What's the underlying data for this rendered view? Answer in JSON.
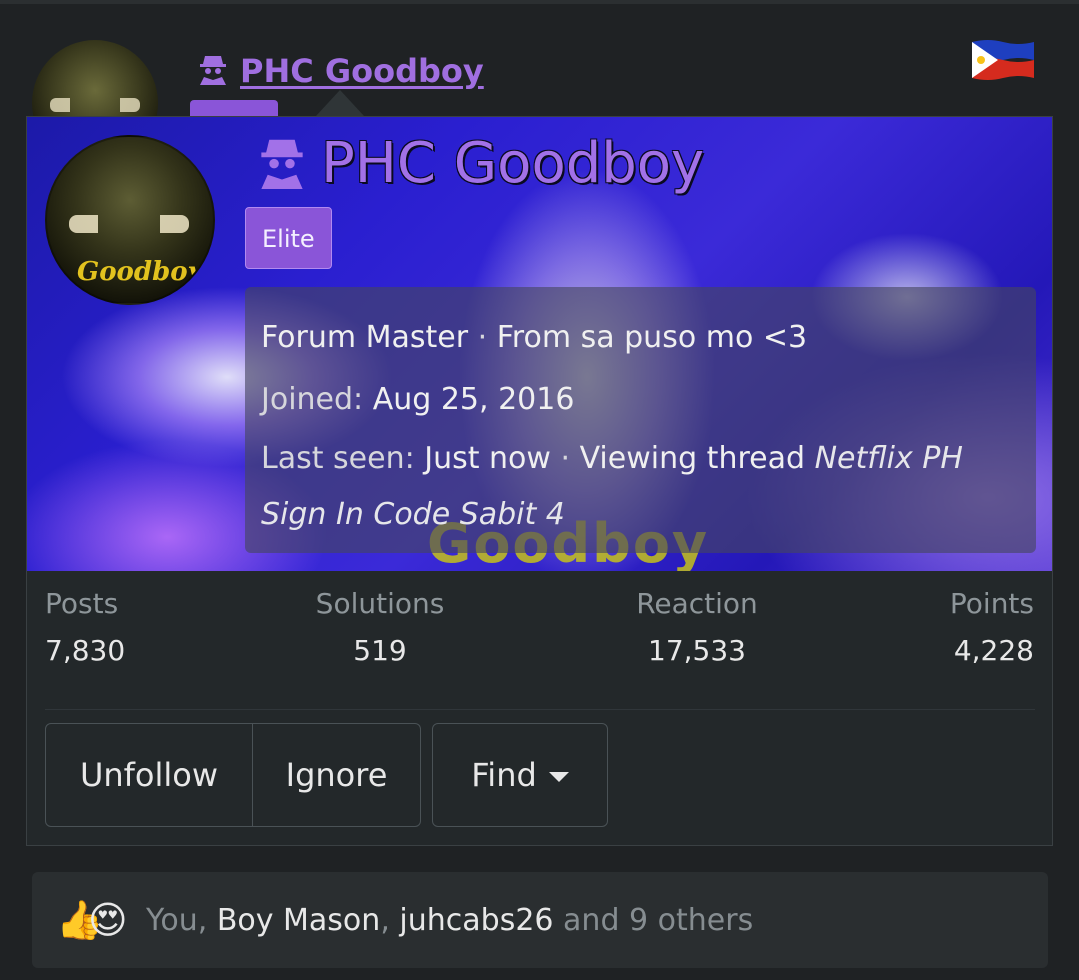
{
  "post": {
    "author_name": "PHC Goodboy",
    "country_flag": "philippines-flag"
  },
  "card": {
    "name": "PHC Goodboy",
    "avatar_text": "Goodboy",
    "banner_text": "Goodboy",
    "badge": "Elite",
    "title": "Forum Master",
    "separator": " · ",
    "from_label": "From",
    "from_value": "sa puso mo <3",
    "joined_label": "Joined:",
    "joined_value": "Aug 25, 2016",
    "last_seen_label": "Last seen:",
    "last_seen_value": "Just now",
    "viewing_label": "Viewing thread",
    "viewing_thread": "Netflix PH Sign In Code Sabit 4",
    "stats": [
      {
        "label": "Posts",
        "value": "7,830"
      },
      {
        "label": "Solutions",
        "value": "519"
      },
      {
        "label": "Reaction",
        "value": "17,533"
      },
      {
        "label": "Points",
        "value": "4,228"
      }
    ],
    "buttons": {
      "unfollow": "Unfollow",
      "ignore": "Ignore",
      "find": "Find"
    }
  },
  "reactions": {
    "icons": [
      "thumbs-up-icon",
      "heart-eyes-icon"
    ],
    "you": "You",
    "comma": ",",
    "user1": "Boy Mason",
    "user2": "juhcabs26",
    "and_others": "and 9 others"
  },
  "colors": {
    "username": "#a06fe0",
    "badge": "#8a55d8",
    "background": "#1f2224"
  }
}
